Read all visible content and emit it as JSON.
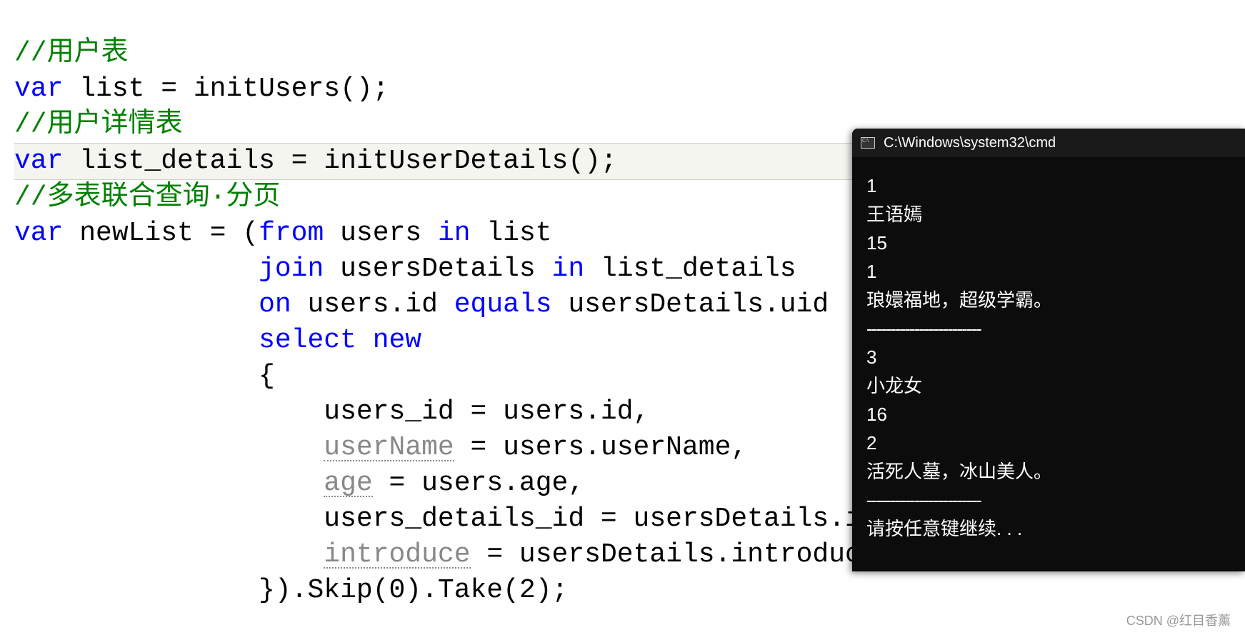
{
  "code": {
    "line1_comment": "//用户表",
    "line2_var": "var",
    "line2_rest": " list = initUsers();",
    "line3_comment": "//用户详情表",
    "line4_var": "var",
    "line4_rest": " list_details = initUserDetails();",
    "line5_comment": "//多表联合查询·分页",
    "line6_var": "var",
    "line6_a": " newList = (",
    "line6_from": "from",
    "line6_b": " users ",
    "line6_in": "in",
    "line6_c": " list",
    "line7_indent": "               ",
    "line7_join": "join",
    "line7_a": " usersDetails ",
    "line7_in": "in",
    "line7_b": " list_details",
    "line8_indent": "               ",
    "line8_on": "on",
    "line8_a": " users.id ",
    "line8_equals": "equals",
    "line8_b": " usersDetails.uid",
    "line9_indent": "               ",
    "line9_select": "select",
    "line9_space": " ",
    "line9_new": "new",
    "line10": "               {",
    "line11": "                   users_id = users.id,",
    "line12_indent": "                   ",
    "line12_unused": "userName",
    "line12_rest": " = users.userName,",
    "line13_indent": "                   ",
    "line13_unused": "age",
    "line13_rest": " = users.age,",
    "line14": "                   users_details_id = usersDetails.id,",
    "line15_indent": "                   ",
    "line15_unused": "introduce",
    "line15_rest": " = usersDetails.introduce",
    "line16": "               }).Skip(0).Take(2);"
  },
  "console": {
    "title": "C:\\Windows\\system32\\cmd",
    "output": {
      "r1_id": "1",
      "r1_name": "王语嫣",
      "r1_age": "15",
      "r1_did": "1",
      "r1_intro": "琅嬛福地，超级学霸。",
      "divider": "------------------------",
      "r2_id": "3",
      "r2_name": "小龙女",
      "r2_age": "16",
      "r2_did": "2",
      "r2_intro": "活死人墓，冰山美人。",
      "prompt": "请按任意键继续. . ."
    }
  },
  "watermark": "CSDN @红目香薰"
}
